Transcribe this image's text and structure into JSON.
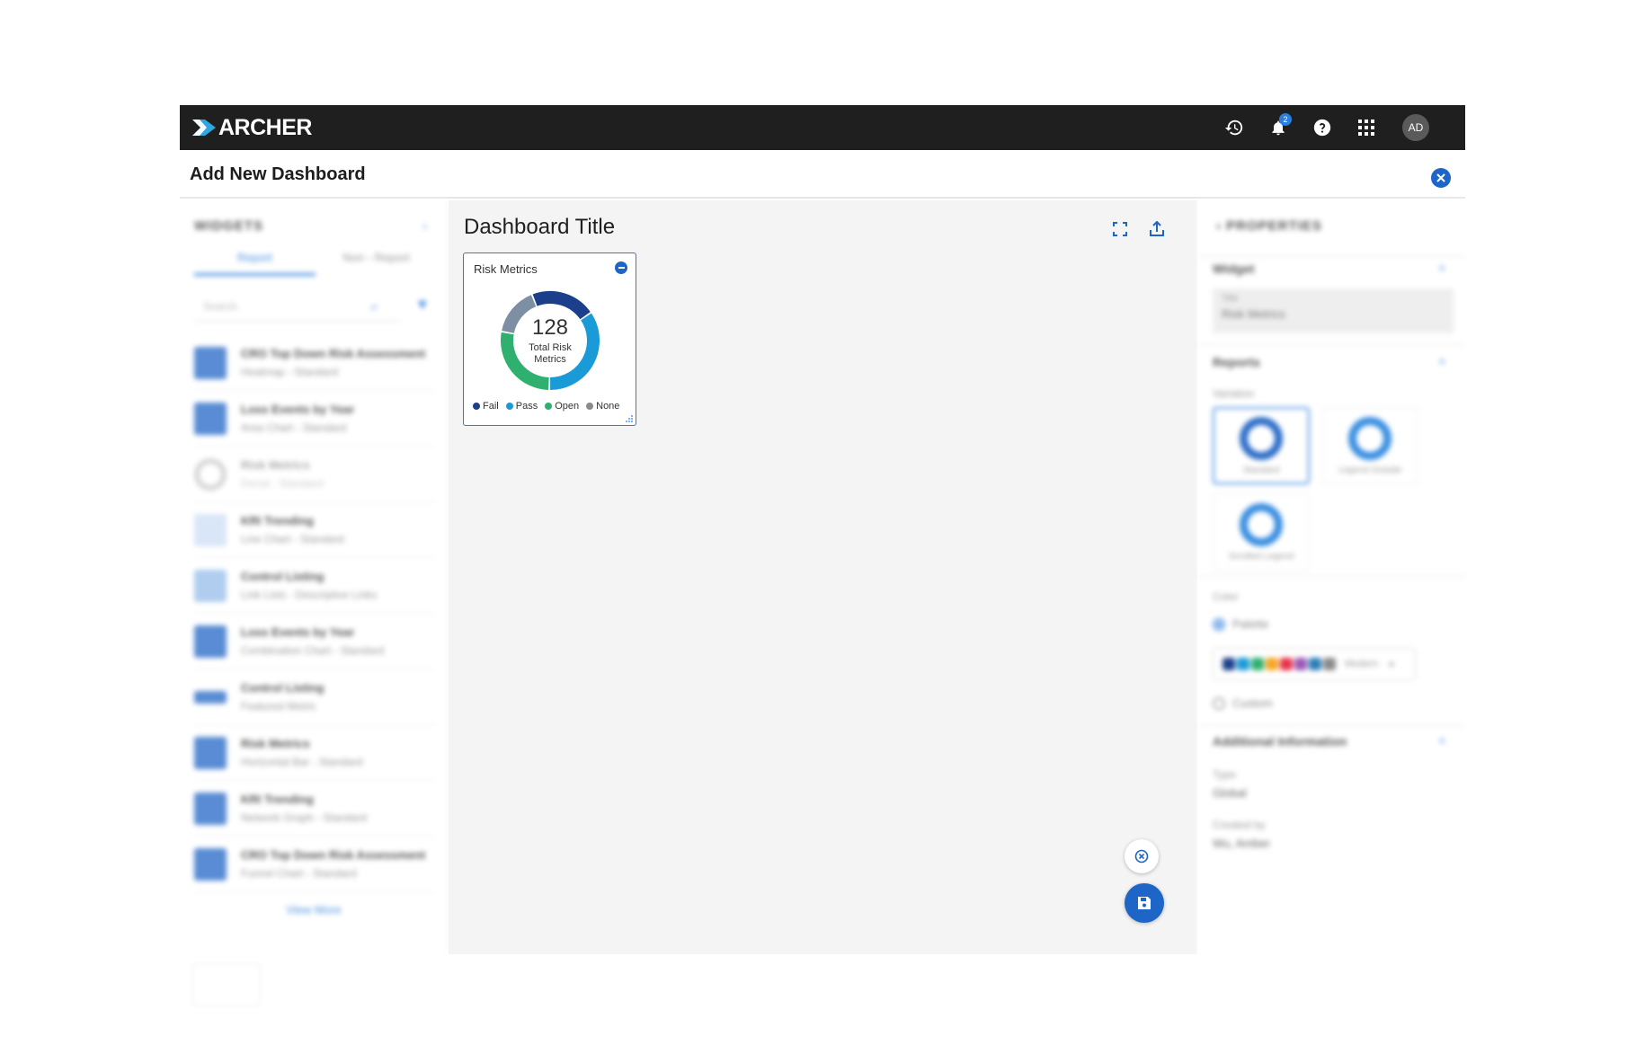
{
  "app": {
    "brand": "ARCHER",
    "notifications_count": "2",
    "avatar_initials": "AD",
    "icons": [
      "history-icon",
      "bell-icon",
      "help-icon",
      "apps-grid-icon"
    ]
  },
  "page": {
    "title": "Add New Dashboard"
  },
  "widgets_panel": {
    "title": "WIDGETS",
    "tabs": [
      "Report",
      "Non - Report"
    ],
    "search_placeholder": "Search",
    "items": [
      {
        "name": "CRO Top Down Risk Assessment",
        "sub": "Heatmap - Standard"
      },
      {
        "name": "Loss Events by Year",
        "sub": "Area Chart - Standard"
      },
      {
        "name": "Risk Metrics",
        "sub": "Donut - Standard"
      },
      {
        "name": "KRI Trending",
        "sub": "Line Chart - Standard"
      },
      {
        "name": "Control Listing",
        "sub": "Link Lists - Descriptive Links"
      },
      {
        "name": "Loss Events by Year",
        "sub": "Combination Chart - Standard"
      },
      {
        "name": "Control Listing",
        "sub": "Featured Metric"
      },
      {
        "name": "Risk Metrics",
        "sub": "Horizontal Bar - Standard"
      },
      {
        "name": "KRI Trending",
        "sub": "Network Graph - Standard"
      },
      {
        "name": "CRO Top Down Risk Assessment",
        "sub": "Funnel Chart - Standard"
      }
    ],
    "view_more": "View More"
  },
  "canvas": {
    "dashboard_title": "Dashboard Title"
  },
  "widget": {
    "title": "Risk Metrics",
    "center_value": "128",
    "center_label": "Total Risk Metrics"
  },
  "chart_data": {
    "type": "pie",
    "title": "Risk Metrics",
    "categories": [
      "Fail",
      "Pass",
      "Open",
      "None"
    ],
    "values": [
      24,
      39,
      31,
      18
    ],
    "colors": {
      "Fail": "#1b3f8b",
      "Pass": "#1a9ad6",
      "Open": "#2fb06e",
      "None": "#8a8a8a"
    },
    "legend_placement": "bottom"
  },
  "properties_panel": {
    "title": "PROPERTIES",
    "widget_section": "Widget",
    "title_field_label": "Title",
    "title_field_value": "Risk Metrics",
    "reports_section": "Reports",
    "variation_label": "Variation",
    "variations": [
      "Standard",
      "Legend Outside",
      "Scrolled Legend"
    ],
    "color_label": "Color",
    "palette_option": "Palette",
    "palette_name": "Modern",
    "custom_option": "Custom",
    "additional_section": "Additional Information",
    "type_label": "Type",
    "type_value": "Global",
    "created_by_label": "Created by",
    "created_by_value": "Wu, Amber"
  }
}
